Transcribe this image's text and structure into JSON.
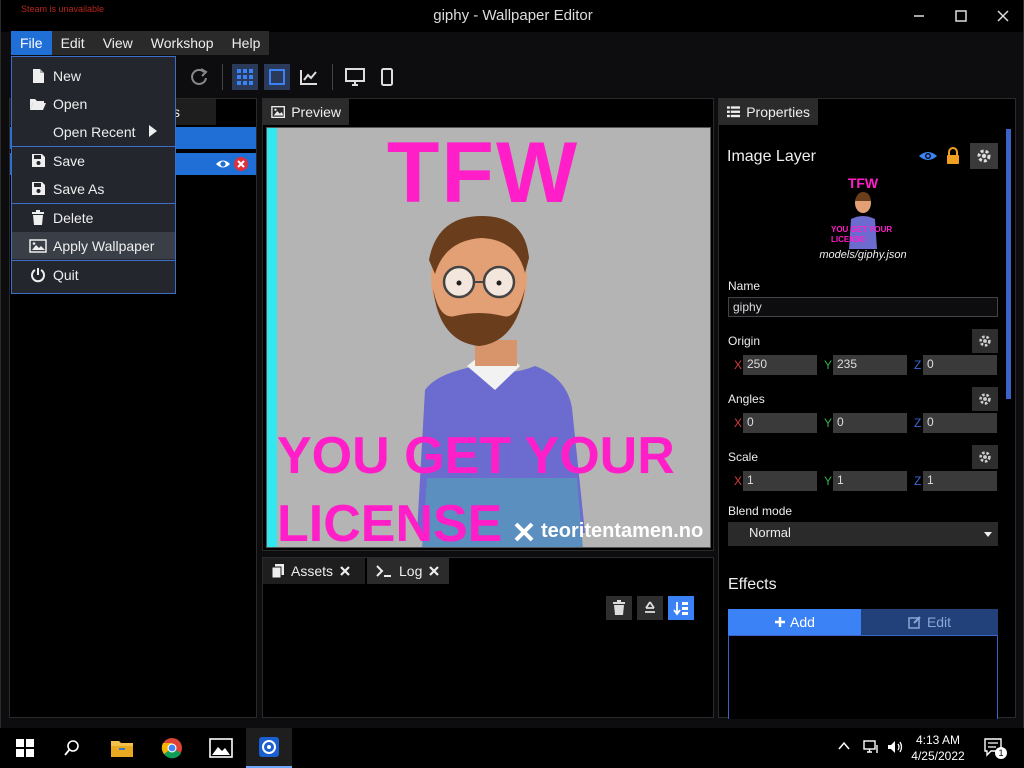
{
  "steam_status": "Steam is unavailable",
  "window": {
    "title": "giphy - Wallpaper Editor"
  },
  "menubar": [
    "File",
    "Edit",
    "View",
    "Workshop",
    "Help"
  ],
  "file_menu": {
    "new": "New",
    "open": "Open",
    "open_recent": "Open Recent",
    "save": "Save",
    "save_as": "Save As",
    "delete": "Delete",
    "apply_wallpaper": "Apply Wallpaper",
    "quit": "Quit"
  },
  "left_panel": {
    "tab_fragment": "ptions"
  },
  "preview": {
    "tab": "Preview",
    "top_text": "TFW",
    "bottom_line1": "YOU GET YOUR",
    "bottom_line2": "LICENSE",
    "watermark": "teoritentamen.no"
  },
  "bottom_panel": {
    "assets_tab": "Assets",
    "log_tab": "Log"
  },
  "properties": {
    "tab": "Properties",
    "layer_title": "Image Layer",
    "thumb_top": "TFW",
    "thumb_bottom": "YOU GET YOUR LICENSE",
    "model_path": "models/giphy.json",
    "name_label": "Name",
    "name_value": "giphy",
    "origin_label": "Origin",
    "origin": {
      "x": "250",
      "y": "235",
      "z": "0"
    },
    "angles_label": "Angles",
    "angles": {
      "x": "0",
      "y": "0",
      "z": "0"
    },
    "scale_label": "Scale",
    "scale": {
      "x": "1",
      "y": "1",
      "z": "1"
    },
    "axis_x": "X",
    "axis_y": "Y",
    "axis_z": "Z",
    "blend_label": "Blend mode",
    "blend_value": "Normal",
    "effects_label": "Effects",
    "add_button": "Add",
    "edit_button": "Edit"
  },
  "taskbar": {
    "time": "4:13 AM",
    "date": "4/25/2022",
    "notification_count": "1"
  },
  "colors": {
    "accent": "#1f6fd6",
    "text_magenta": "#ff1ec8",
    "axis_x": "#d23b3b",
    "axis_y": "#2fb24a",
    "axis_z": "#3b66d2",
    "lock": "#f0a020"
  }
}
